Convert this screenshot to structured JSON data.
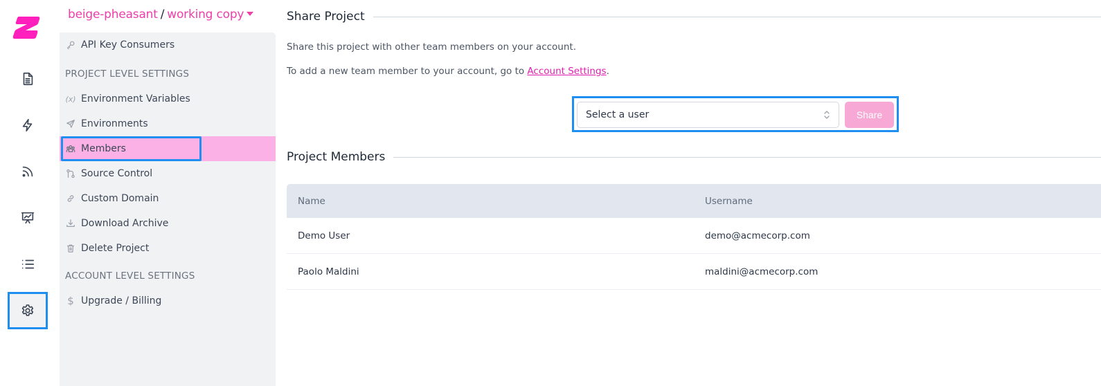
{
  "brand": {
    "logo": "z-logo",
    "accent": "#ee3ea8",
    "focus": "#1f8ef1"
  },
  "rail": {
    "items": [
      {
        "name": "docs",
        "icon": "document-icon"
      },
      {
        "name": "actions",
        "icon": "lightning-icon"
      },
      {
        "name": "feed",
        "icon": "rss-icon"
      },
      {
        "name": "analytics",
        "icon": "presentation-chart-icon"
      },
      {
        "name": "list",
        "icon": "list-icon"
      },
      {
        "name": "settings",
        "icon": "gear-icon",
        "active": true
      }
    ]
  },
  "breadcrumb": {
    "project": "beige-pheasant",
    "separator": "/",
    "branch": "working copy"
  },
  "sidebar": {
    "top_items": [
      {
        "label": "API Key Consumers",
        "icon": "key-icon"
      }
    ],
    "project_section": "PROJECT LEVEL SETTINGS",
    "project_items": [
      {
        "label": "Environment Variables",
        "icon": "variable-icon"
      },
      {
        "label": "Environments",
        "icon": "paper-plane-icon"
      },
      {
        "label": "Members",
        "icon": "users-icon",
        "active": true
      },
      {
        "label": "Source Control",
        "icon": "git-branch-icon"
      },
      {
        "label": "Custom Domain",
        "icon": "link-icon"
      },
      {
        "label": "Download Archive",
        "icon": "download-icon"
      },
      {
        "label": "Delete Project",
        "icon": "trash-icon"
      }
    ],
    "account_section": "ACCOUNT LEVEL SETTINGS",
    "account_items": [
      {
        "label": "Upgrade / Billing",
        "icon": "dollar-icon"
      }
    ]
  },
  "share": {
    "title": "Share Project",
    "description": "Share this project with other team members on your account.",
    "hint_prefix": "To add a new team member to your account, go to ",
    "hint_link": "Account Settings",
    "hint_suffix": ".",
    "select_placeholder": "Select a user",
    "button": "Share"
  },
  "members": {
    "title": "Project Members",
    "columns": [
      "Name",
      "Username"
    ],
    "rows": [
      {
        "name": "Demo User",
        "username": "demo@acmecorp.com"
      },
      {
        "name": "Paolo Maldini",
        "username": "maldini@acmecorp.com"
      }
    ]
  }
}
